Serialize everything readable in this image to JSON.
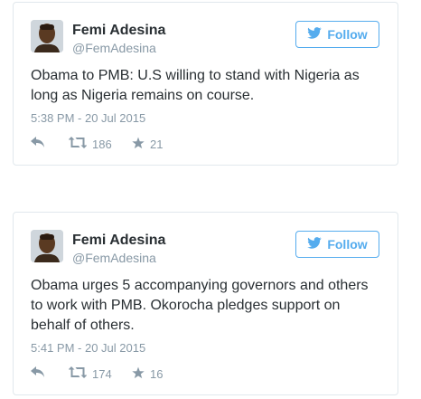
{
  "colors": {
    "accent": "#55acee",
    "muted": "#8899a6",
    "text": "#292f33",
    "border": "#e1e8ed"
  },
  "tweets": [
    {
      "author_name": "Femi Adesina",
      "handle": "@FemAdesina",
      "follow_label": "Follow",
      "text": "Obama to PMB: U.S willing to stand with Nigeria as long as Nigeria remains on course.",
      "timestamp": "5:38 PM - 20 Jul 2015",
      "retweets": "186",
      "likes": "21"
    },
    {
      "author_name": "Femi Adesina",
      "handle": "@FemAdesina",
      "follow_label": "Follow",
      "text": "Obama urges 5 accompanying governors and others to work with PMB. Okorocha pledges support on behalf of others.",
      "timestamp": "5:41 PM - 20 Jul 2015",
      "retweets": "174",
      "likes": "16"
    }
  ],
  "icons": {
    "avatar": "avatar",
    "follow": "twitter-bird-icon",
    "reply": "reply-icon",
    "retweet": "retweet-icon",
    "like": "star-icon"
  }
}
